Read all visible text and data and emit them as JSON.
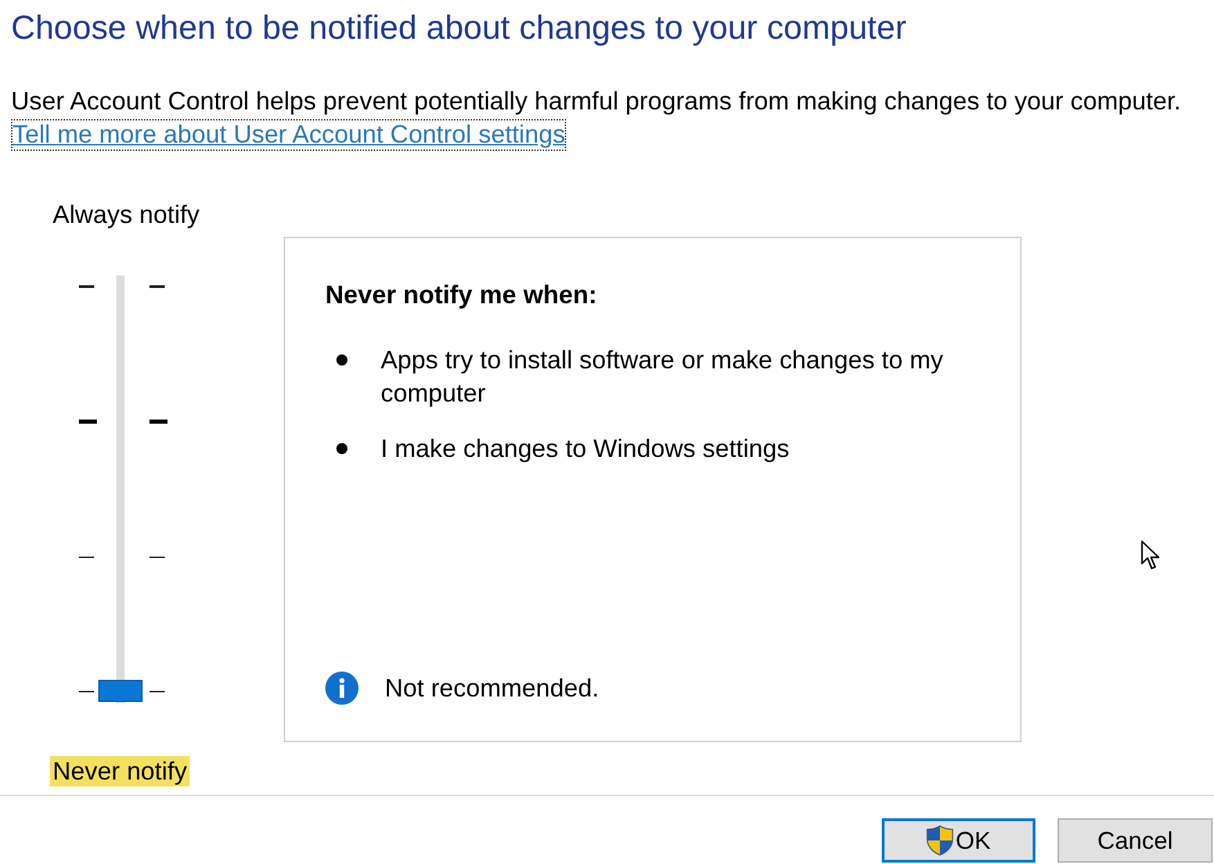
{
  "title": "Choose when to be notified about changes to your computer",
  "description": "User Account Control helps prevent potentially harmful programs from making changes to your computer.",
  "help_link": {
    "text": "Tell me more about User Account Control settings",
    "focused": true
  },
  "slider": {
    "top_label": {
      "text": "Always notify",
      "highlighted": false
    },
    "bottom_label": {
      "text": "Never notify",
      "highlighted": true
    },
    "level": 0
  },
  "details": {
    "heading": "Never notify me when:",
    "items": [
      "Apps try to install software or make changes to my computer",
      "I make changes to Windows settings"
    ],
    "note": "Not recommended."
  },
  "buttons": [
    {
      "label": "OK",
      "default": true,
      "shield": true
    },
    {
      "label": "Cancel",
      "default": false,
      "shield": false
    }
  ]
}
